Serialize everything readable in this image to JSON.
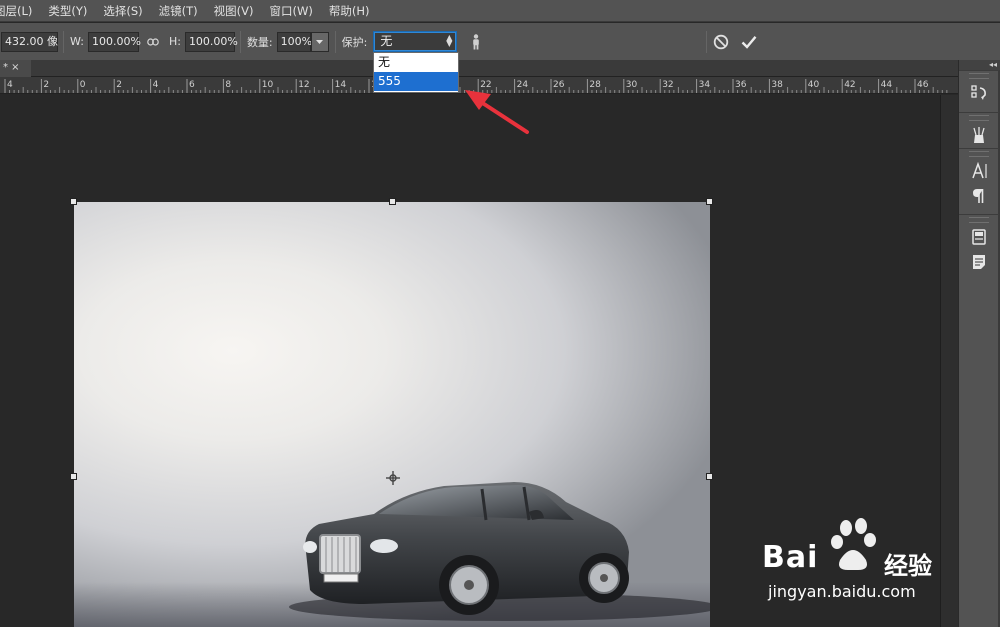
{
  "menubar": {
    "items": [
      "图层(L)",
      "类型(Y)",
      "选择(S)",
      "滤镜(T)",
      "视图(V)",
      "窗口(W)",
      "帮助(H)"
    ]
  },
  "options": {
    "size_value": "432.00 像",
    "w_label": "W:",
    "w_value": "100.00%",
    "h_label": "H:",
    "h_value": "100.00%",
    "density_label": "数量:",
    "density_value": "100%",
    "protect_label": "保护:",
    "protect_value": "无"
  },
  "protect_dropdown": {
    "options": [
      "无",
      "555"
    ],
    "selected_index": 1
  },
  "tab": {
    "label": "* ×"
  },
  "ruler": {
    "labels": [
      "4",
      "2",
      "0",
      "2",
      "4",
      "6",
      "8",
      "10",
      "12",
      "14",
      "16",
      "18",
      "20",
      "22",
      "24",
      "26",
      "28",
      "30",
      "32",
      "34",
      "36",
      "38",
      "40",
      "42",
      "44",
      "46"
    ]
  },
  "watermark": {
    "line1": "Bai",
    "line1_suffix": "经验",
    "line2": "jingyan.baidu.com"
  },
  "right_panel": {
    "collapse_label": "◂◂"
  },
  "colors": {
    "ui_bg": "#535353",
    "canvas_bg": "#282828",
    "selection_blue": "#1e6fd0",
    "arrow_red": "#e8323c"
  },
  "icons": [
    "link-icon",
    "dropdown-arrow-icon",
    "puppet-figure-icon",
    "cancel-icon",
    "commit-check-icon",
    "history-icon",
    "brush-preset-icon",
    "character-icon",
    "paragraph-icon",
    "layer-comps-icon",
    "notes-icon"
  ]
}
